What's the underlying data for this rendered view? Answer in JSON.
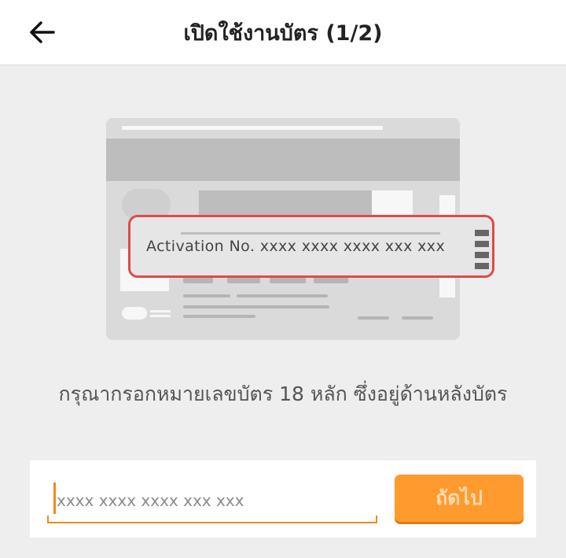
{
  "header": {
    "title": "เปิดใช้งานบัตร (1/2)",
    "back_icon": "arrow-left-icon"
  },
  "card_illustration": {
    "highlight_text": "Activation No. xxxx xxxx xxxx xxx xxx",
    "highlight_color": "#e04a4a"
  },
  "instruction": {
    "text": "กรุณากรอกหมายเลขบัตร 18 หลัก ซึ่งอยู่ด้านหลังบัตร"
  },
  "form": {
    "input_placeholder": "xxxx xxxx xxxx xxx xxx",
    "input_value": "",
    "next_label": "ถัดไป",
    "accent_color": "#ff9a2e"
  }
}
